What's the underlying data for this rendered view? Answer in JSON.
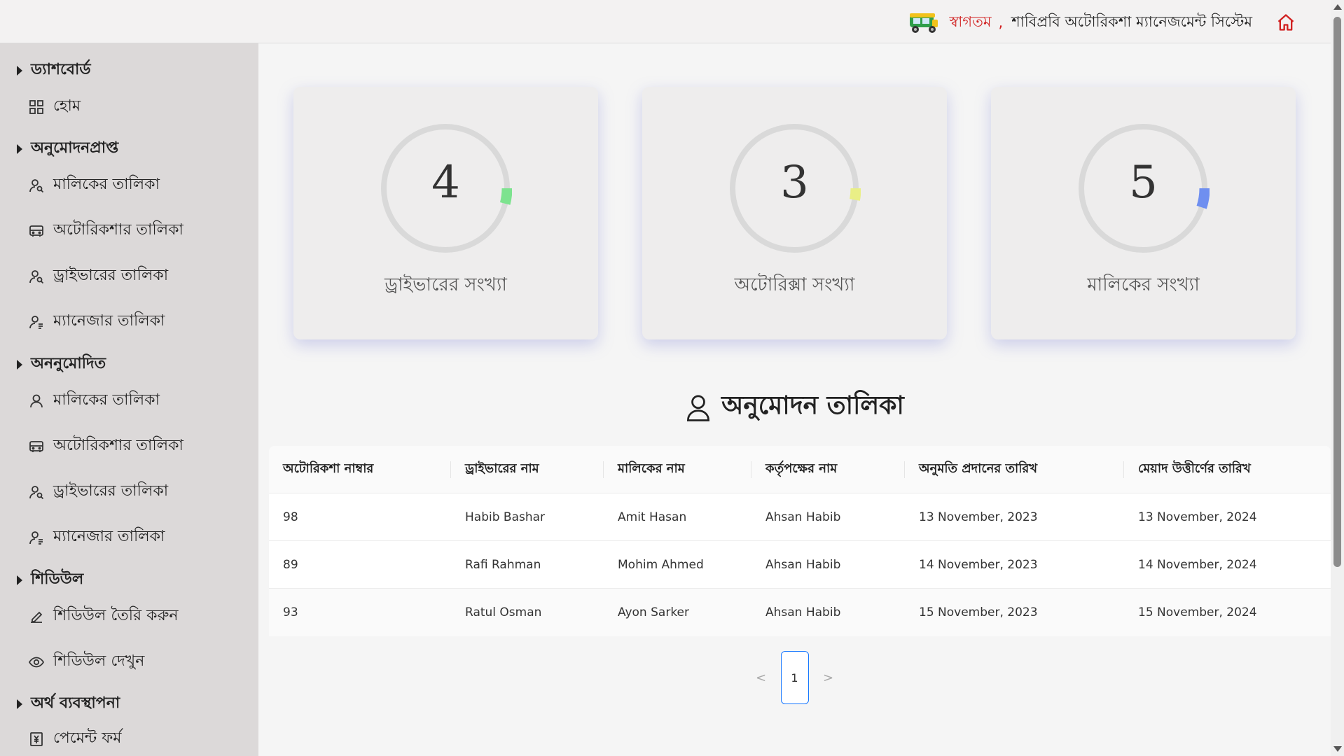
{
  "header": {
    "welcome": "স্বাগতম",
    "comma": ",",
    "system_name": "শাবিপ্রবি অটোরিকশা ম্যানেজমেন্ট সিস্টেম",
    "logo_icon": "autorickshaw-icon",
    "home_icon": "home-icon",
    "accent_color": "#d12222"
  },
  "sidebar": {
    "sections": [
      {
        "label": "ড্যাশবোর্ড",
        "items": [
          {
            "label": "হোম",
            "icon": "grid-icon"
          }
        ]
      },
      {
        "label": "অনুমোদনপ্রাপ্ত",
        "items": [
          {
            "label": "মালিকের তালিকা",
            "icon": "user-search-icon"
          },
          {
            "label": "অটোরিকশার তালিকা",
            "icon": "car-icon"
          },
          {
            "label": "ড্রাইভারের তালিকা",
            "icon": "user-search-icon"
          },
          {
            "label": "ম্যানেজার তালিকা",
            "icon": "user-list-icon"
          }
        ]
      },
      {
        "label": "অননুমোদিত",
        "items": [
          {
            "label": "মালিকের তালিকা",
            "icon": "user-icon"
          },
          {
            "label": "অটোরিকশার তালিকা",
            "icon": "car-icon"
          },
          {
            "label": "ড্রাইভারের তালিকা",
            "icon": "user-search-icon"
          },
          {
            "label": "ম্যানেজার তালিকা",
            "icon": "user-list-icon"
          }
        ]
      },
      {
        "label": "শিডিউল",
        "items": [
          {
            "label": "শিডিউল তৈরি করুন",
            "icon": "edit-icon"
          },
          {
            "label": "শিডিউল দেখুন",
            "icon": "eye-icon"
          }
        ]
      },
      {
        "label": "অর্থ ব্যবস্থাপনা",
        "items": [
          {
            "label": "পেমেন্ট ফর্ম",
            "icon": "yen-receipt-icon"
          }
        ]
      }
    ]
  },
  "stats": [
    {
      "value": "4",
      "label": "ড্রাইভারের সংখ্যা",
      "color": "#7de38f",
      "fraction": 0.04
    },
    {
      "value": "3",
      "label": "অটোরিক্সা সংখ্যা",
      "color": "#e9ef86",
      "fraction": 0.03
    },
    {
      "value": "5",
      "label": "মালিকের সংখ্যা",
      "color": "#6f8ff0",
      "fraction": 0.05
    }
  ],
  "approval": {
    "title": "অনুমোদন তালিকা",
    "title_icon": "user-icon",
    "columns": [
      "অটোরিকশা নাম্বার",
      "ড্রাইভারের নাম",
      "মালিকের নাম",
      "কর্তৃপক্ষের নাম",
      "অনুমতি প্রদানের তারিখ",
      "মেয়াদ উত্তীর্ণের তারিখ"
    ],
    "rows": [
      [
        "98",
        "Habib Bashar",
        "Amit Hasan",
        "Ahsan Habib",
        "13 November, 2023",
        "13 November, 2024"
      ],
      [
        "89",
        "Rafi Rahman",
        "Mohim Ahmed",
        "Ahsan Habib",
        "14 November, 2023",
        "14 November, 2024"
      ],
      [
        "93",
        "Ratul Osman",
        "Ayon Sarker",
        "Ahsan Habib",
        "15 November, 2023",
        "15 November, 2024"
      ]
    ]
  },
  "pagination": {
    "prev": "<",
    "current": "1",
    "next": ">"
  }
}
